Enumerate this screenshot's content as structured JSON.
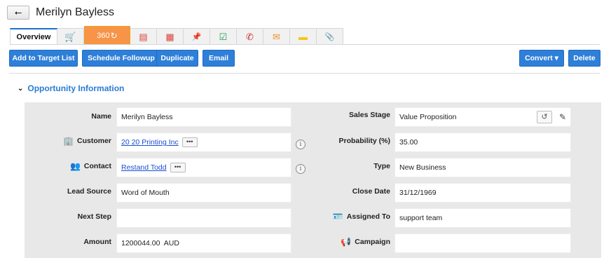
{
  "header": {
    "back_icon": "back-arrow-icon",
    "back_glyph": "⭠",
    "title": "Merilyn Bayless"
  },
  "tabs": [
    {
      "label": "Overview",
      "icon": null
    },
    {
      "label": "",
      "icon": "cart-icon",
      "glyph": "🛒",
      "color": "#1f9d55"
    },
    {
      "label": "360",
      "icon": "refresh-360-icon",
      "glyph": "↻",
      "color": "#ffffff"
    },
    {
      "label": "",
      "icon": "quote-icon",
      "glyph": "▤",
      "color": "#d6453b"
    },
    {
      "label": "",
      "icon": "calendar-icon",
      "glyph": "▦",
      "color": "#d6453b"
    },
    {
      "label": "",
      "icon": "pin-icon",
      "glyph": "📌",
      "color": "#2b63c8"
    },
    {
      "label": "",
      "icon": "task-icon",
      "glyph": "☑",
      "color": "#1f9d55"
    },
    {
      "label": "",
      "icon": "call-icon",
      "glyph": "✆",
      "color": "#c9302c"
    },
    {
      "label": "",
      "icon": "mail-icon",
      "glyph": "✉",
      "color": "#f0902a"
    },
    {
      "label": "",
      "icon": "note-icon",
      "glyph": "▬",
      "color": "#f5c518"
    },
    {
      "label": "",
      "icon": "attachment-icon",
      "glyph": "📎",
      "color": "#2b63c8"
    }
  ],
  "actions": {
    "add_to_target_list": "Add to Target List",
    "schedule_followup": "Schedule Followup",
    "duplicate": "Duplicate",
    "email": "Email",
    "convert": "Convert ▾",
    "delete": "Delete"
  },
  "section": {
    "title": "Opportunity Information",
    "chevron": "⌄"
  },
  "fields": {
    "name": {
      "label": "Name",
      "value": "Merilyn Bayless"
    },
    "customer": {
      "label": "Customer",
      "value": "20 20 Printing Inc",
      "more": "•••",
      "icon": "building-icon"
    },
    "contact": {
      "label": "Contact",
      "value": "Restand Todd",
      "more": "•••",
      "icon": "contact-icon"
    },
    "lead_source": {
      "label": "Lead Source",
      "value": "Word of Mouth"
    },
    "next_step": {
      "label": "Next Step",
      "value": ""
    },
    "amount": {
      "label": "Amount",
      "value": "1200044.00  AUD"
    },
    "sales_stage": {
      "label": "Sales Stage",
      "value": "Value Proposition"
    },
    "probability": {
      "label": "Probability (%)",
      "value": "35.00"
    },
    "type": {
      "label": "Type",
      "value": "New Business"
    },
    "close_date": {
      "label": "Close Date",
      "value": "31/12/1969"
    },
    "assigned_to": {
      "label": "Assigned To",
      "value": "support team",
      "icon": "id-card-icon"
    },
    "campaign": {
      "label": "Campaign",
      "value": "",
      "icon": "megaphone-icon"
    }
  },
  "glyphs": {
    "info": "i",
    "history": "↺",
    "pencil": "✎",
    "building": "🏢",
    "contact": "👥",
    "id_card": "🪪",
    "megaphone": "📢"
  },
  "colors": {
    "primary_button": "#2e7fd8",
    "link": "#1a4ed1",
    "section_title": "#2b7bd3",
    "tab_360": "#f79447",
    "panel_bg": "#e8e8e8"
  }
}
